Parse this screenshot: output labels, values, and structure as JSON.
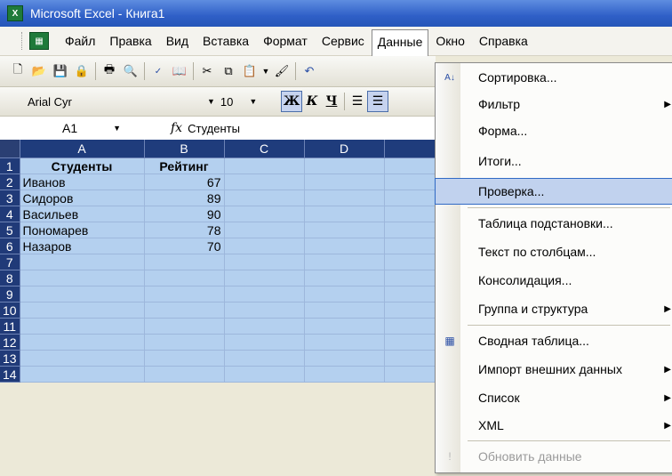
{
  "window": {
    "title": "Microsoft Excel - Книга1",
    "app_icon": "excel-icon"
  },
  "menubar": {
    "items": [
      "Файл",
      "Правка",
      "Вид",
      "Вставка",
      "Формат",
      "Сервис",
      "Данные",
      "Окно",
      "Справка"
    ],
    "open_item": "Данные"
  },
  "format": {
    "font": "Arial Cyr",
    "size": "10",
    "bold": "Ж",
    "italic": "К",
    "underline": "Ч"
  },
  "formula": {
    "cell": "A1",
    "fx": "fx",
    "value": "Студенты"
  },
  "sheet": {
    "columns": [
      "A",
      "B",
      "C",
      "D"
    ],
    "rows": [
      {
        "n": "1",
        "a": "Студенты",
        "b": "Рейтинг"
      },
      {
        "n": "2",
        "a": "Иванов",
        "b": "67"
      },
      {
        "n": "3",
        "a": "Сидоров",
        "b": "89"
      },
      {
        "n": "4",
        "a": "Васильев",
        "b": "90"
      },
      {
        "n": "5",
        "a": "Пономарев",
        "b": "78"
      },
      {
        "n": "6",
        "a": "Назаров",
        "b": "70"
      },
      {
        "n": "7",
        "a": "",
        "b": ""
      },
      {
        "n": "8",
        "a": "",
        "b": ""
      },
      {
        "n": "9",
        "a": "",
        "b": ""
      },
      {
        "n": "10",
        "a": "",
        "b": ""
      },
      {
        "n": "11",
        "a": "",
        "b": ""
      },
      {
        "n": "12",
        "a": "",
        "b": ""
      },
      {
        "n": "13",
        "a": "",
        "b": ""
      },
      {
        "n": "14",
        "a": "",
        "b": ""
      }
    ]
  },
  "data_menu": {
    "items": [
      {
        "label": "Сортировка...",
        "icon": "sort-icon"
      },
      {
        "label": "Фильтр",
        "submenu": true
      },
      {
        "label": "Форма..."
      },
      {
        "label": "Итоги..."
      },
      {
        "label": "Проверка...",
        "highlighted": true
      },
      {
        "label": "Таблица подстановки..."
      },
      {
        "label": "Текст по столбцам..."
      },
      {
        "label": "Консолидация..."
      },
      {
        "label": "Группа и структура",
        "submenu": true
      },
      {
        "label": "Сводная таблица...",
        "icon": "pivot-table-icon"
      },
      {
        "label": "Импорт внешних данных",
        "submenu": true
      },
      {
        "label": "Список",
        "submenu": true
      },
      {
        "label": "XML",
        "submenu": true
      },
      {
        "label": "Обновить данные",
        "disabled": true,
        "icon": "refresh-icon"
      }
    ]
  },
  "colors": {
    "selection": "#b4d0ef",
    "header": "#1f3c7c",
    "menu_highlight": "#c1d2ee"
  }
}
